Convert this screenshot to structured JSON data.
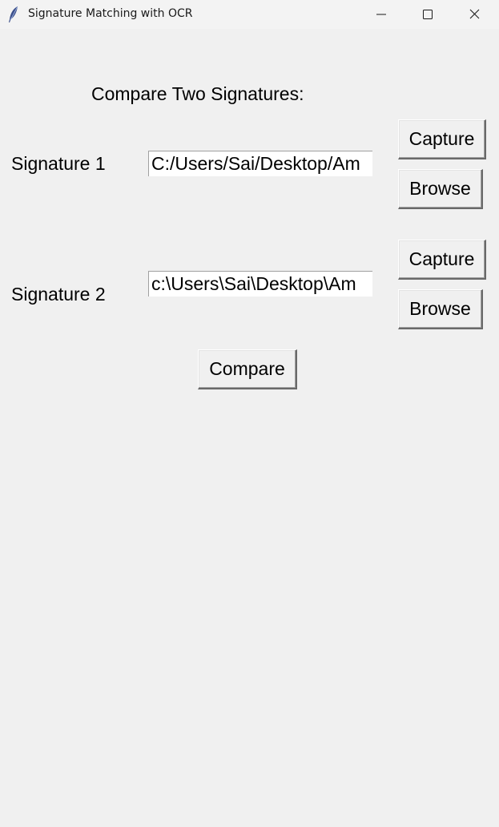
{
  "window": {
    "title": "Signature Matching with OCR",
    "icon": "feather-icon",
    "controls": [
      "minimize-icon",
      "maximize-icon",
      "close-icon"
    ]
  },
  "main": {
    "heading": "Compare Two Signatures:",
    "signature1": {
      "label": "Signature 1",
      "path_value": "C:/Users/Sai/Desktop/Am",
      "capture_label": "Capture",
      "browse_label": "Browse"
    },
    "signature2": {
      "label": "Signature 2",
      "path_value": "c:\\Users\\Sai\\Desktop\\Am",
      "capture_label": "Capture",
      "browse_label": "Browse"
    },
    "compare_label": "Compare"
  },
  "colors": {
    "background": "#f0f0f0",
    "titlebar": "#f3f3f3",
    "input_bg": "#ffffff",
    "text": "#000000"
  }
}
